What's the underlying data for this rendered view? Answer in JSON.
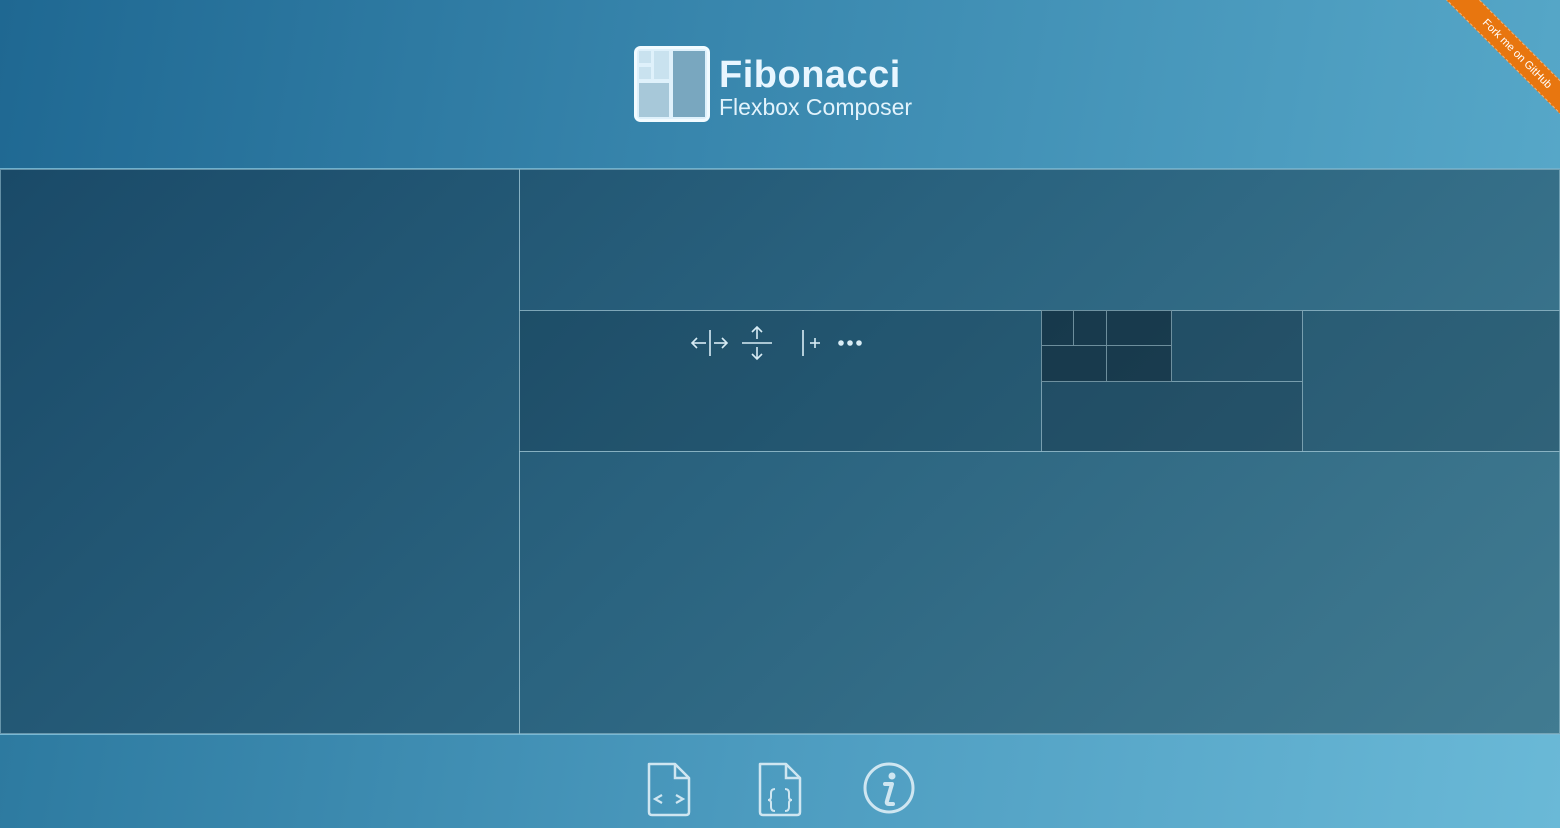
{
  "header": {
    "logo_title": "Fibonacci",
    "logo_subtitle": "Flexbox Composer",
    "ribbon_label": "Fork me on GitHub",
    "ribbon_color": "#e8760f"
  },
  "toolbar": {
    "icons": [
      "split-horizontal-icon",
      "split-vertical-icon",
      "add-icon",
      "more-icon"
    ]
  },
  "footer": {
    "buttons": [
      "html-code-icon",
      "css-code-icon",
      "info-icon"
    ]
  }
}
